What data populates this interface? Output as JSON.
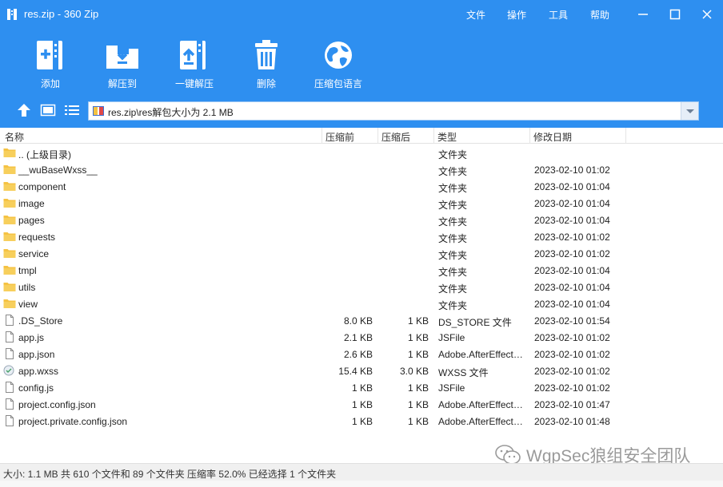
{
  "window": {
    "title": "res.zip - 360 Zip",
    "menus": [
      "文件",
      "操作",
      "工具",
      "帮助"
    ]
  },
  "toolbar": {
    "add_label": "添加",
    "extract_to_label": "解压到",
    "one_click_label": "一键解压",
    "delete_label": "删除",
    "language_label": "压缩包语言"
  },
  "address": {
    "path": "res.zip\\res解包大小为 2.1 MB"
  },
  "columns": {
    "name": "名称",
    "packed": "压缩前",
    "compressed": "压缩后",
    "type": "类型",
    "modified": "修改日期"
  },
  "rows": [
    {
      "name": ".. (上级目录)",
      "psize": "",
      "csize": "",
      "type": "文件夹",
      "date": "",
      "icon": "folder-icon"
    },
    {
      "name": "__wuBaseWxss__",
      "psize": "",
      "csize": "",
      "type": "文件夹",
      "date": "2023-02-10 01:02",
      "icon": "folder-icon"
    },
    {
      "name": "component",
      "psize": "",
      "csize": "",
      "type": "文件夹",
      "date": "2023-02-10 01:04",
      "icon": "folder-icon"
    },
    {
      "name": "image",
      "psize": "",
      "csize": "",
      "type": "文件夹",
      "date": "2023-02-10 01:04",
      "icon": "folder-icon"
    },
    {
      "name": "pages",
      "psize": "",
      "csize": "",
      "type": "文件夹",
      "date": "2023-02-10 01:04",
      "icon": "folder-icon"
    },
    {
      "name": "requests",
      "psize": "",
      "csize": "",
      "type": "文件夹",
      "date": "2023-02-10 01:02",
      "icon": "folder-icon"
    },
    {
      "name": "service",
      "psize": "",
      "csize": "",
      "type": "文件夹",
      "date": "2023-02-10 01:02",
      "icon": "folder-icon"
    },
    {
      "name": "tmpl",
      "psize": "",
      "csize": "",
      "type": "文件夹",
      "date": "2023-02-10 01:04",
      "icon": "folder-icon"
    },
    {
      "name": "utils",
      "psize": "",
      "csize": "",
      "type": "文件夹",
      "date": "2023-02-10 01:04",
      "icon": "folder-icon"
    },
    {
      "name": "view",
      "psize": "",
      "csize": "",
      "type": "文件夹",
      "date": "2023-02-10 01:04",
      "icon": "folder-icon"
    },
    {
      "name": ".DS_Store",
      "psize": "8.0 KB",
      "csize": "1 KB",
      "type": "DS_STORE 文件",
      "date": "2023-02-10 01:54",
      "icon": "file-icon"
    },
    {
      "name": "app.js",
      "psize": "2.1 KB",
      "csize": "1 KB",
      "type": "JSFile",
      "date": "2023-02-10 01:02",
      "icon": "file-icon"
    },
    {
      "name": "app.json",
      "psize": "2.6 KB",
      "csize": "1 KB",
      "type": "Adobe.AfterEffects.Script",
      "date": "2023-02-10 01:02",
      "icon": "file-icon"
    },
    {
      "name": "app.wxss",
      "psize": "15.4 KB",
      "csize": "3.0 KB",
      "type": "WXSS 文件",
      "date": "2023-02-10 01:02",
      "icon": "wxss-file-icon"
    },
    {
      "name": "config.js",
      "psize": "1 KB",
      "csize": "1 KB",
      "type": "JSFile",
      "date": "2023-02-10 01:02",
      "icon": "file-icon"
    },
    {
      "name": "project.config.json",
      "psize": "1 KB",
      "csize": "1 KB",
      "type": "Adobe.AfterEffects.Script",
      "date": "2023-02-10 01:47",
      "icon": "file-icon"
    },
    {
      "name": "project.private.config.json",
      "psize": "1 KB",
      "csize": "1 KB",
      "type": "Adobe.AfterEffects.Script",
      "date": "2023-02-10 01:48",
      "icon": "file-icon"
    }
  ],
  "watermark": "WgpSec狼组安全团队",
  "status": "大小: 1.1 MB 共 610 个文件和 89 个文件夹 压缩率 52.0% 已经选择 1 个文件夹",
  "colors": {
    "accent": "#2e8ff0",
    "folder": "#f5c242"
  }
}
